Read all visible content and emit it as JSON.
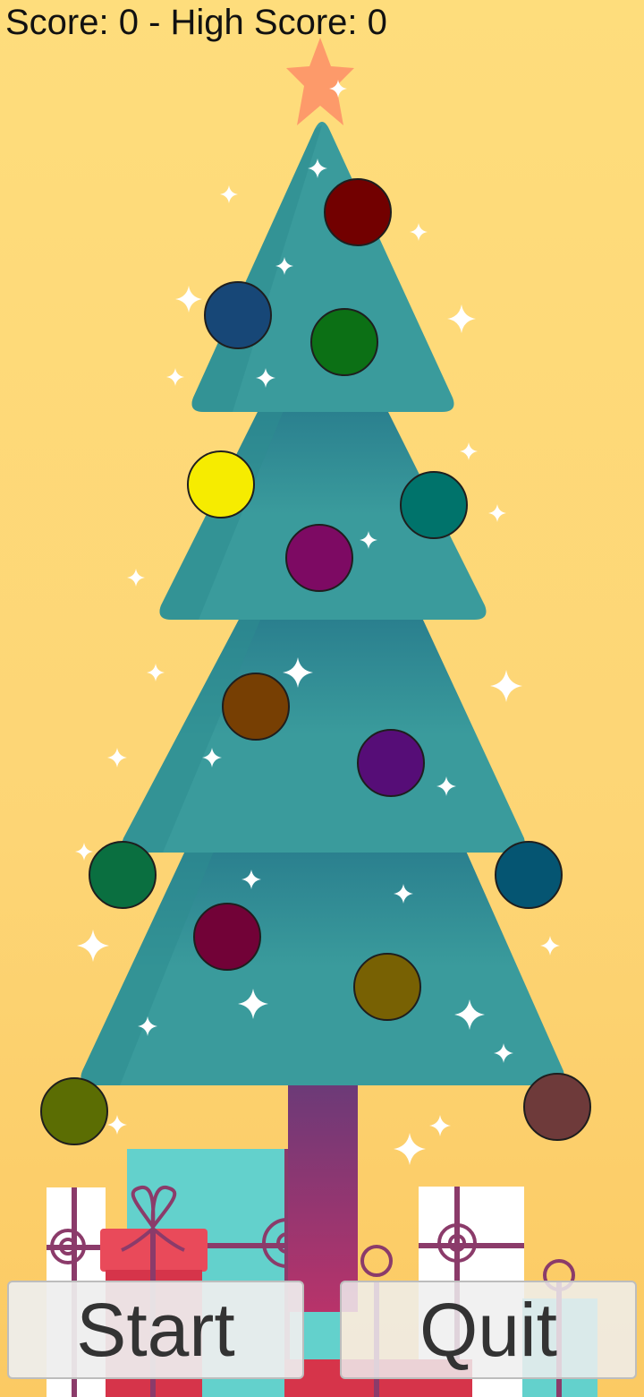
{
  "hud": {
    "score_text": "Score: 0 - High Score: 0"
  },
  "buttons": {
    "start_label": "Start",
    "quit_label": "Quit"
  },
  "colors": {
    "background": "#fdd775",
    "tree": "#3a9b9c",
    "tree_shadow": "#2e8d90",
    "trunk_top": "#6a3a78",
    "trunk_bottom": "#b8336a",
    "star": "#fd9a6a",
    "sparkle": "#ffffff"
  },
  "ornaments": [
    {
      "name": "ornament-dark-red",
      "color": "#720000"
    },
    {
      "name": "ornament-navy",
      "color": "#174777"
    },
    {
      "name": "ornament-green",
      "color": "#0c7015"
    },
    {
      "name": "ornament-yellow",
      "color": "#f6ec00"
    },
    {
      "name": "ornament-teal",
      "color": "#00736b"
    },
    {
      "name": "ornament-magenta",
      "color": "#7d0a63"
    },
    {
      "name": "ornament-brown",
      "color": "#773f03"
    },
    {
      "name": "ornament-purple",
      "color": "#560d77"
    },
    {
      "name": "ornament-forest-green",
      "color": "#0a6f40"
    },
    {
      "name": "ornament-petrol-blue",
      "color": "#055572"
    },
    {
      "name": "ornament-maroon",
      "color": "#720237"
    },
    {
      "name": "ornament-olive",
      "color": "#786103"
    },
    {
      "name": "ornament-olive-green",
      "color": "#5b6d03"
    },
    {
      "name": "ornament-rosewood",
      "color": "#6e3a3a"
    }
  ]
}
